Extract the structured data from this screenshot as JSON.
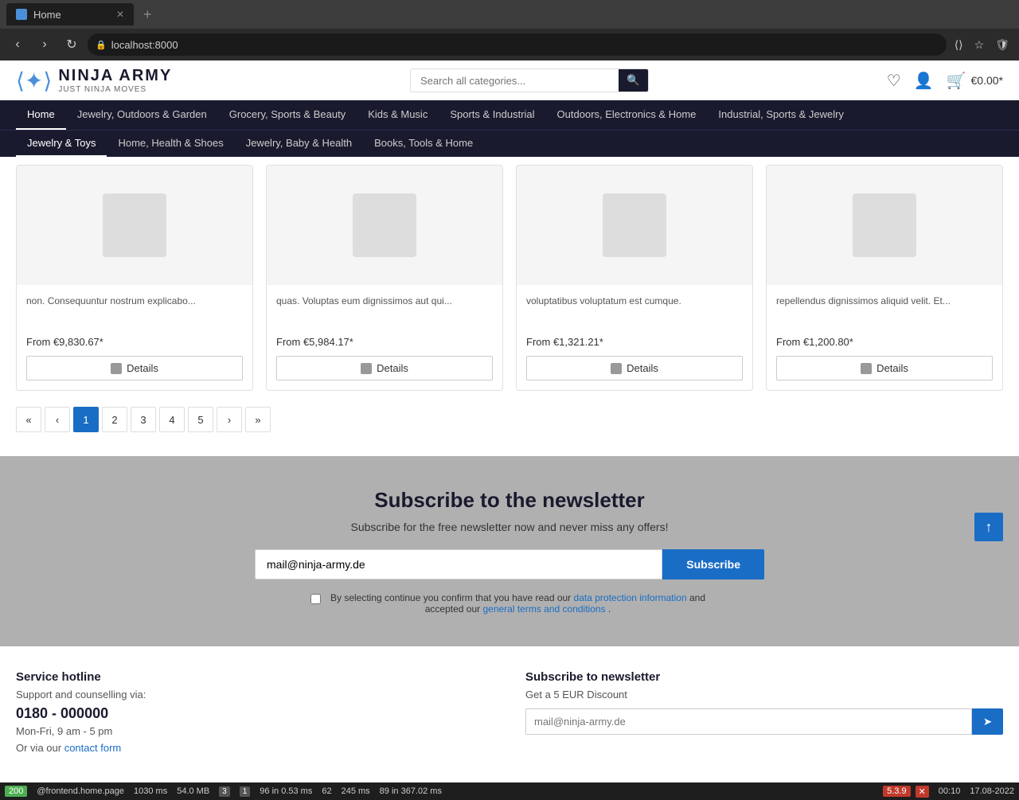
{
  "browser": {
    "tab_title": "Home",
    "tab_favicon": "H",
    "address": "localhost:8000",
    "nav_back": "‹",
    "nav_forward": "›",
    "nav_refresh": "↺",
    "new_tab_btn": "+",
    "close_btn": "✕"
  },
  "header": {
    "logo_icon": "⟨✦⟩",
    "logo_main": "NINJA ARMY",
    "logo_sub": "JUST NINJA MOVES",
    "search_placeholder": "Search all categories...",
    "search_btn_icon": "🔍",
    "cart_price": "€0.00*"
  },
  "primary_nav": {
    "items": [
      {
        "label": "Home",
        "active": true
      },
      {
        "label": "Jewelry, Outdoors & Garden",
        "active": false
      },
      {
        "label": "Grocery, Sports & Beauty",
        "active": false
      },
      {
        "label": "Kids & Music",
        "active": false
      },
      {
        "label": "Sports & Industrial",
        "active": false
      },
      {
        "label": "Outdoors, Electronics & Home",
        "active": false
      },
      {
        "label": "Industrial, Sports & Jewelry",
        "active": false
      }
    ]
  },
  "secondary_nav": {
    "items": [
      {
        "label": "Jewelry & Toys",
        "active": true
      },
      {
        "label": "Home, Health & Shoes",
        "active": false
      },
      {
        "label": "Jewelry, Baby & Health",
        "active": false
      },
      {
        "label": "Books, Tools & Home",
        "active": false
      }
    ]
  },
  "products": [
    {
      "desc": "non. Consequuntur nostrum explicabo...",
      "price": "From €9,830.67*",
      "btn_label": "Details"
    },
    {
      "desc": "quas. Voluptas eum dignissimos aut qui...",
      "price": "From €5,984.17*",
      "btn_label": "Details"
    },
    {
      "desc": "voluptatibus voluptatum est cumque.",
      "price": "From €1,321.21*",
      "btn_label": "Details"
    },
    {
      "desc": "repellendus dignissimos aliquid velit. Et...",
      "price": "From €1,200.80*",
      "btn_label": "Details"
    }
  ],
  "pagination": {
    "first": "«",
    "prev": "‹",
    "pages": [
      "1",
      "2",
      "3",
      "4",
      "5"
    ],
    "active_page": "1",
    "next": "›",
    "last": "»"
  },
  "newsletter": {
    "title": "Subscribe to the newsletter",
    "subtitle": "Subscribe for the free newsletter now and never miss any offers!",
    "email_value": "mail@ninja-army.de",
    "email_placeholder": "mail@ninja-army.de",
    "btn_label": "Subscribe",
    "consent_text": "By selecting continue you confirm that you have read our",
    "consent_link1": "data protection information",
    "consent_and": "and accepted our",
    "consent_link2": "general terms and conditions",
    "consent_end": "."
  },
  "footer": {
    "hotline_title": "Service hotline",
    "hotline_support": "Support and counselling via:",
    "hotline_phone": "0180 - 000000",
    "hotline_hours": "Mon-Fri, 9 am - 5 pm",
    "hotline_contact_pre": "Or via our",
    "hotline_contact_link": "contact form",
    "newsletter_title": "Subscribe to newsletter",
    "newsletter_discount": "Get a 5 EUR Discount",
    "footer_email_placeholder": "mail@ninja-army.de"
  },
  "status_bar": {
    "item1": "200",
    "item2": "@frontend.home.page",
    "item3": "1030 ms",
    "item4": "54.0 MB",
    "item5": "3",
    "item6": "1",
    "item7": "96 in 0.53 ms",
    "item8": "62",
    "item9": "245 ms",
    "item10": "89 in 367.02 ms",
    "item11": "5.3.9",
    "time": "00:10",
    "date": "17.08-2022"
  }
}
